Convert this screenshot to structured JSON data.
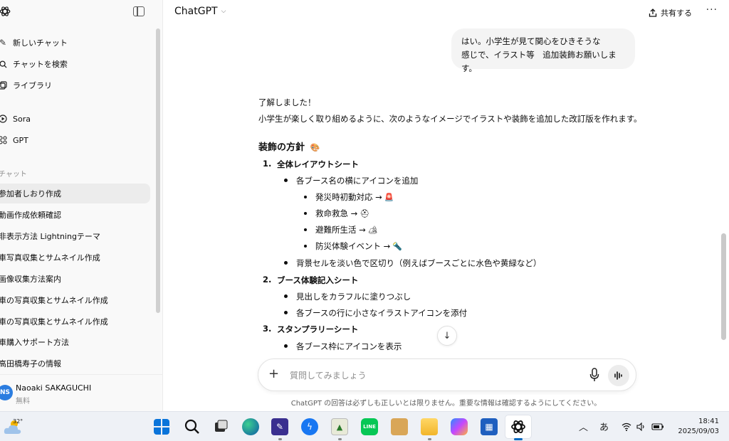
{
  "sidebar": {
    "top_items": [
      {
        "icon": "edit-icon",
        "label": "新しいチャット"
      },
      {
        "icon": "search-icon",
        "label": "チャットを検索"
      },
      {
        "icon": "library-icon",
        "label": "ライブラリ"
      },
      {
        "icon": "sora-icon",
        "label": "Sora"
      },
      {
        "icon": "gpt-grid-icon",
        "label": "GPT"
      }
    ],
    "section_label": "チャット",
    "chats": [
      "参加者しおり作成",
      "動画作成依頼確認",
      "非表示方法 Lightningテーマ",
      "車写真収集とサムネイル作成",
      "画像収集方法案内",
      "車の写真収集とサムネイル作成",
      "車の写真収集とサムネイル作成",
      "車購入サポート方法",
      "高田橋寿子の情報"
    ],
    "user": {
      "initials": "NS",
      "name": "Naoaki SAKAGUCHI",
      "plan": "無料"
    }
  },
  "header": {
    "model": "ChatGPT",
    "share_label": "共有する",
    "more_label": "···"
  },
  "conversation": {
    "user_message": {
      "line1": "はい。小学生が見て関心をひきそうな",
      "line2": "感じで、イラスト等　追加装飾お願いします。"
    },
    "assistant": {
      "intro1": "了解しました！",
      "intro2": "小学生が楽しく取り組めるように、次のようなイメージでイラストや装飾を追加した改訂版を作れます。",
      "heading": "装飾の方針",
      "heading_emoji": "🎨",
      "sections": [
        {
          "num": "1.",
          "title": "全体レイアウトシート",
          "bullets": [
            {
              "text": "各ブース名の横にアイコンを追加"
            },
            {
              "text": "背景セルを淡い色で区切り（例えばブースごとに水色や黄緑など）"
            }
          ],
          "sub_bullets": [
            {
              "text": "発災時初動対応 →",
              "emoji": "🚨"
            },
            {
              "text": "救命救急 →",
              "emoji": "⛑"
            },
            {
              "text": "避難所生活 →",
              "emoji": "🏕"
            },
            {
              "text": "防災体験イベント →",
              "emoji": "🔦"
            }
          ]
        },
        {
          "num": "2.",
          "title": "ブース体験記入シート",
          "bullets": [
            {
              "text": "見出しをカラフルに塗りつぶし"
            },
            {
              "text": "各ブースの行に小さなイラストアイコンを添付"
            }
          ]
        },
        {
          "num": "3.",
          "title": "スタンプラリーシート",
          "bullets": [
            {
              "text": "各ブース枠にアイコンを表示"
            }
          ]
        }
      ]
    }
  },
  "composer": {
    "placeholder": "質問してみましょう",
    "plus_label": "+"
  },
  "disclaimer": "ChatGPT の回答は必ずしも正しいとは限りません。重要な情報は確認するようにしてください。",
  "taskbar": {
    "temperature": "32°",
    "ime_label": "あ",
    "time": "18:41",
    "date": "2025/09/03"
  },
  "colors": {
    "accent_blue": "#0067c0",
    "avatar": "#2b7de0",
    "bubble": "#f4f4f4"
  }
}
